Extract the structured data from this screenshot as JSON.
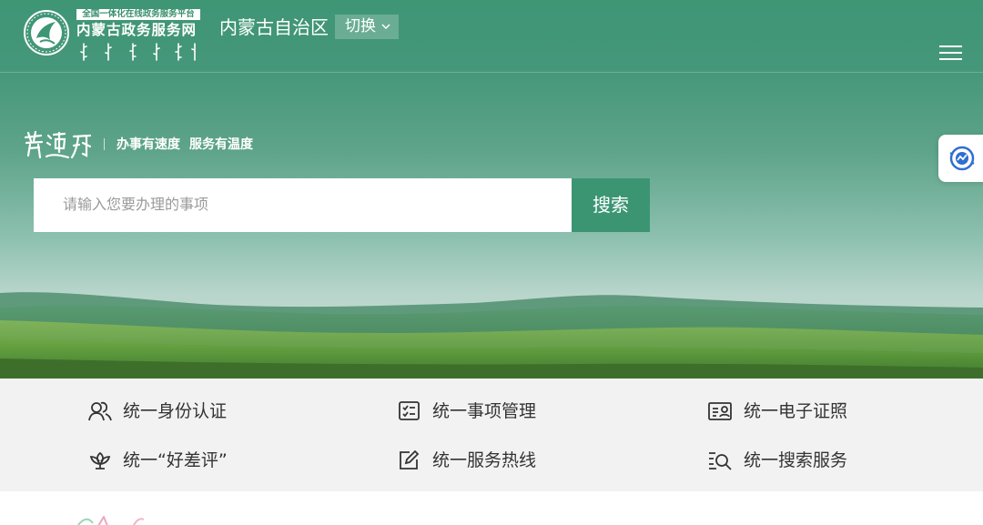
{
  "header": {
    "platform_label": "全国一体化在线政务服务平台",
    "site_name": "内蒙古政务服务网",
    "region": "内蒙古自治区",
    "switch_label": "切换",
    "menu_icon": "hamburger-menu-icon"
  },
  "slogan": {
    "brand": "蒙速办",
    "part1": "办事有速度",
    "part2": "服务有温度"
  },
  "search": {
    "placeholder": "请输入您要办理的事项",
    "value": "",
    "button_label": "搜索"
  },
  "services": [
    {
      "label": "统一身份认证",
      "icon": "users-icon"
    },
    {
      "label": "统一事项管理",
      "icon": "checklist-icon"
    },
    {
      "label": "统一电子证照",
      "icon": "id-card-icon"
    },
    {
      "label": "统一“好差评”",
      "icon": "lotus-icon"
    },
    {
      "label": "统一服务热线",
      "icon": "edit-icon"
    },
    {
      "label": "统一搜索服务",
      "icon": "search-list-icon"
    }
  ],
  "colors": {
    "brand_green": "#3b9573",
    "service_bg": "#f2f2f2",
    "text_dark": "#333333"
  }
}
